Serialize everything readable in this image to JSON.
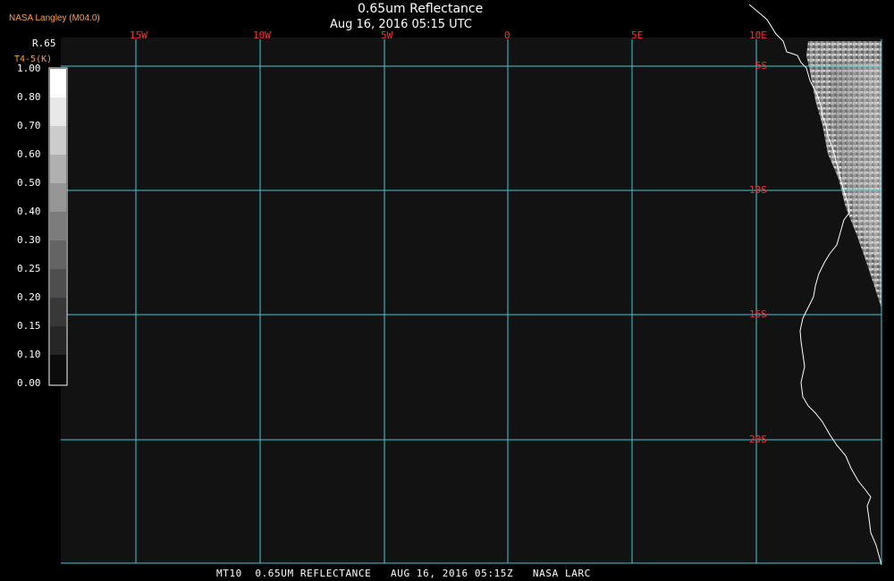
{
  "header": {
    "agency": "NASA Langley (M04.0)",
    "title": "0.65um Reflectance",
    "datetime": "Aug 16, 2016 05:15 UTC"
  },
  "colorbar": {
    "label_top": "R.65",
    "label_bottom": "T4-5(K)",
    "ticks": [
      "1.00",
      "0.80",
      "0.70",
      "0.60",
      "0.50",
      "0.40",
      "0.30",
      "0.25",
      "0.20",
      "0.15",
      "0.10",
      "0.00"
    ]
  },
  "grid": {
    "longitudes": [
      "15W",
      "10W",
      "5W",
      "0",
      "5E",
      "10E"
    ],
    "latitudes": [
      "5S",
      "10S",
      "15S",
      "20S"
    ],
    "line_color": "#40c8d8",
    "label_color": "#ff3030"
  },
  "footer": "MT10  0.65UM REFLECTANCE   AUG 16, 2016 05:15Z   NASA LARC",
  "colors": {
    "ocean": "#121212",
    "coastline": "#ffffff",
    "background": "#000000"
  }
}
